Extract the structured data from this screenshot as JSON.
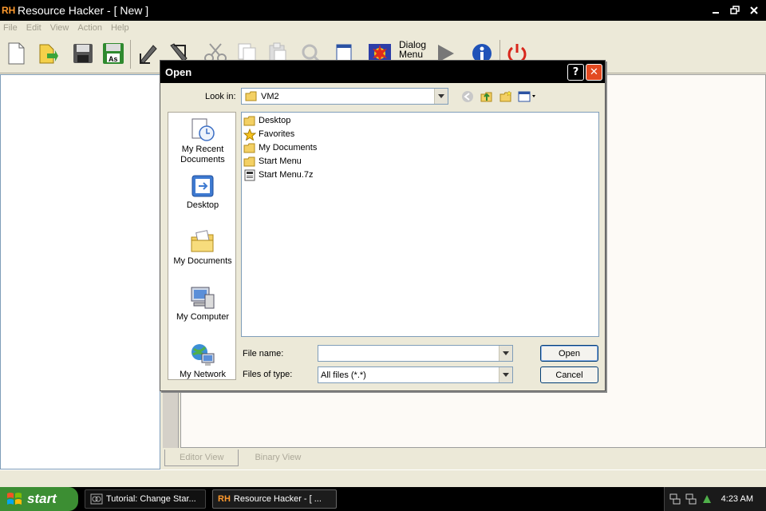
{
  "app": {
    "logo": "RH",
    "title": "Resource Hacker - [ New ]",
    "menu": [
      "File",
      "Edit",
      "View",
      "Action",
      "Help"
    ],
    "toolbar_dialog_label_1": "Dialog",
    "toolbar_dialog_label_2": "Menu",
    "view_tabs": [
      "Editor View",
      "Binary View"
    ]
  },
  "dialog": {
    "title": "Open",
    "help": "?",
    "close": "✕",
    "look_in_label": "Look in:",
    "look_in_value": "VM2",
    "places": [
      {
        "label_1": "My Recent",
        "label_2": "Documents"
      },
      {
        "label_1": "Desktop",
        "label_2": ""
      },
      {
        "label_1": "My Documents",
        "label_2": ""
      },
      {
        "label_1": "My Computer",
        "label_2": ""
      },
      {
        "label_1": "My Network",
        "label_2": ""
      }
    ],
    "files": [
      {
        "name": "Desktop",
        "icon": "folder-icon"
      },
      {
        "name": "Favorites",
        "icon": "star-folder-icon"
      },
      {
        "name": "My Documents",
        "icon": "folder-icon"
      },
      {
        "name": "Start Menu",
        "icon": "folder-icon"
      },
      {
        "name": "Start Menu.7z",
        "icon": "archive-file-icon"
      }
    ],
    "file_name_label": "File name:",
    "file_name_value": "",
    "files_of_type_label": "Files of type:",
    "files_of_type_value": "All files (*.*)",
    "open_button": "Open",
    "cancel_button": "Cancel"
  },
  "taskbar": {
    "start_label": "start",
    "tasks": [
      "Tutorial: Change Star...",
      "Resource Hacker - [ ..."
    ],
    "clock": "4:23 AM"
  },
  "colors": {
    "start_green": "#3c8e33",
    "close_red": "#e34a21",
    "titlebar": "#000000",
    "dialog_face": "#ece9d8"
  }
}
